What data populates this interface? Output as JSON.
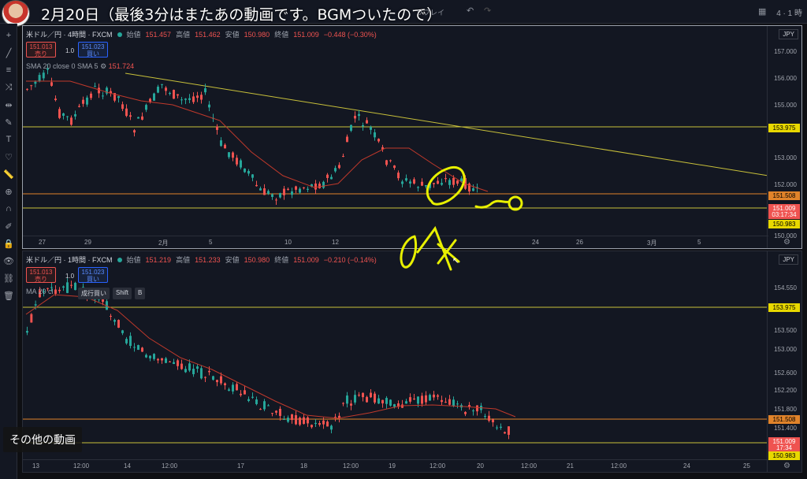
{
  "video": {
    "title": "2月20日（最後3分はまたあの動画です。BGMついたので）",
    "more_videos": "その他の動画"
  },
  "topbar": {
    "replay": "リプレイ",
    "right_text": "4 · 1 時"
  },
  "colors": {
    "up": "#26a69a",
    "down": "#ef5350",
    "sma": "#c0392b",
    "hline_yellow": "#c8c03a",
    "hline_orange": "#e0832a",
    "trend": "#c8c03a",
    "drawing": "#e8f000"
  },
  "tools": [
    "crosshair-icon",
    "trendline-icon",
    "fib-icon",
    "pattern-icon",
    "measure-icon",
    "brush-icon",
    "text-icon",
    "heart-icon",
    "ruler-icon",
    "zoom-icon",
    "magnet-icon",
    "lock-draw-icon",
    "lock-icon",
    "eye-icon",
    "link-icon",
    "trash-icon"
  ],
  "panes": [
    {
      "symbol": "米ドル／円 · 4時間 · FXCM",
      "ohlc": {
        "o_label": "始値",
        "o": "151.457",
        "h_label": "高値",
        "h": "151.462",
        "l_label": "安値",
        "l": "150.980",
        "c_label": "終値",
        "c": "151.009",
        "chg": "−0.448 (−0.30%)"
      },
      "sell": {
        "price": "151.013",
        "label": "売り"
      },
      "buy": {
        "price": "151.023",
        "label": "買い"
      },
      "spread": "1.0",
      "sma": {
        "label": "SMA 20 close 0 SMA 5",
        "value": "151.724"
      },
      "currency": "JPY",
      "price_ticks": [
        "157.000",
        "156.000",
        "155.000",
        "153.000",
        "152.000",
        "150.000"
      ],
      "price_tags": [
        {
          "text": "153.975",
          "bg": "#e8d800"
        },
        {
          "text": "151.508",
          "bg": "#e0832a"
        },
        {
          "text": "151.009",
          "bg": "#ef5350"
        },
        {
          "text": "03:17:34",
          "bg": "#ef5350"
        },
        {
          "text": "150.983",
          "bg": "#e8d800"
        }
      ],
      "time_ticks": [
        "27",
        "29",
        "2月",
        "5",
        "10",
        "12",
        "24",
        "26",
        "3月",
        "5"
      ]
    },
    {
      "symbol": "米ドル／円 · 1時間 · FXCM",
      "ohlc": {
        "o_label": "始値",
        "o": "151.219",
        "h_label": "高値",
        "h": "151.233",
        "l_label": "安値",
        "l": "150.980",
        "c_label": "終値",
        "c": "151.009",
        "chg": "−0.210 (−0.14%)"
      },
      "sell": {
        "price": "151.013",
        "label": "売り"
      },
      "buy": {
        "price": "151.023",
        "label": "買い"
      },
      "spread": "1.0",
      "sma": {
        "label": "MA 20 cl",
        "value": ""
      },
      "tooltip": {
        "text": "成行買い",
        "key1": "Shift",
        "key2": "B"
      },
      "currency": "JPY",
      "price_ticks": [
        "154.550",
        "153.500",
        "153.000",
        "152.600",
        "152.200",
        "151.800",
        "151.400"
      ],
      "price_tags": [
        {
          "text": "153.975",
          "bg": "#e8d800"
        },
        {
          "text": "151.508",
          "bg": "#e0832a"
        },
        {
          "text": "151.009",
          "bg": "#ef5350"
        },
        {
          "text": "17:34",
          "bg": "#ef5350"
        },
        {
          "text": "150.983",
          "bg": "#e8d800"
        }
      ],
      "time_ticks": [
        "13",
        "12:00",
        "14",
        "12:00",
        "17",
        "18",
        "12:00",
        "19",
        "12:00",
        "20",
        "12:00",
        "21",
        "12:00",
        "24",
        "25"
      ]
    }
  ]
}
